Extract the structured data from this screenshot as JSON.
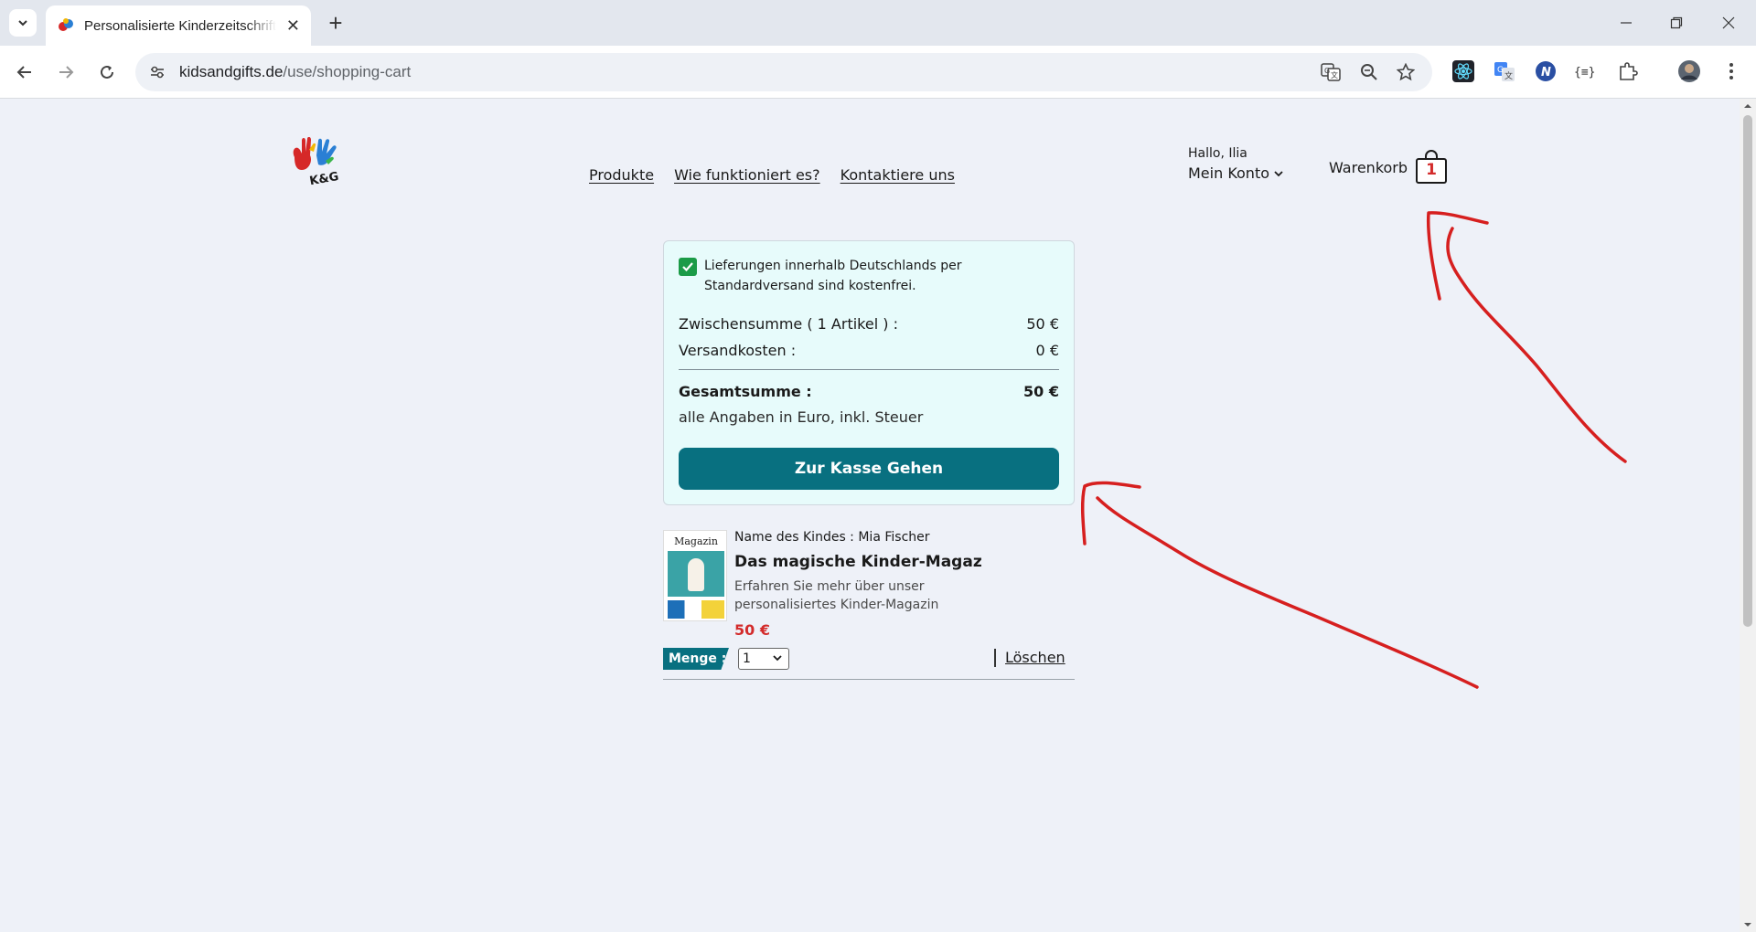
{
  "browser": {
    "tab_title": "Personalisierte Kinderzeitschriften",
    "url_domain": "kidsandgifts.de",
    "url_path": "/use/shopping-cart"
  },
  "header": {
    "nav": [
      "Produkte",
      "Wie funktioniert es?",
      "Kontaktiere uns"
    ],
    "greeting": "Hallo, Ilia",
    "account_label": "Mein Konto",
    "cart_label": "Warenkorb",
    "cart_count": "1",
    "logo_text": "K&G"
  },
  "summary": {
    "notice": "Lieferungen innerhalb Deutschlands per Standardversand sind kostenfrei.",
    "subtotal_label": "Zwischensumme ( 1 Artikel ) :",
    "subtotal_value": "50 €",
    "shipping_label": "Versandkosten :",
    "shipping_value": "0 €",
    "total_label": "Gesamtsumme :",
    "total_value": "50 €",
    "tax_note": "alle Angaben in Euro, inkl. Steuer",
    "checkout_label": "Zur Kasse Gehen"
  },
  "item": {
    "thumb_title": "Magazin",
    "child_name": "Name des Kindes : Mia Fischer",
    "product": "Das magische Kinder-Magazin –...",
    "description": "Erfahren Sie mehr über unser personalisiertes Kinder-Magazin",
    "price": "50 €",
    "qty_label": "Menge :",
    "qty_value": "1",
    "delete_label": "Löschen"
  },
  "colors": {
    "accent": "#087080",
    "price_red": "#d32b2b",
    "checkbox_green": "#1b9b47",
    "summary_bg": "#e7fbfb",
    "annotation": "#d61f1f"
  }
}
